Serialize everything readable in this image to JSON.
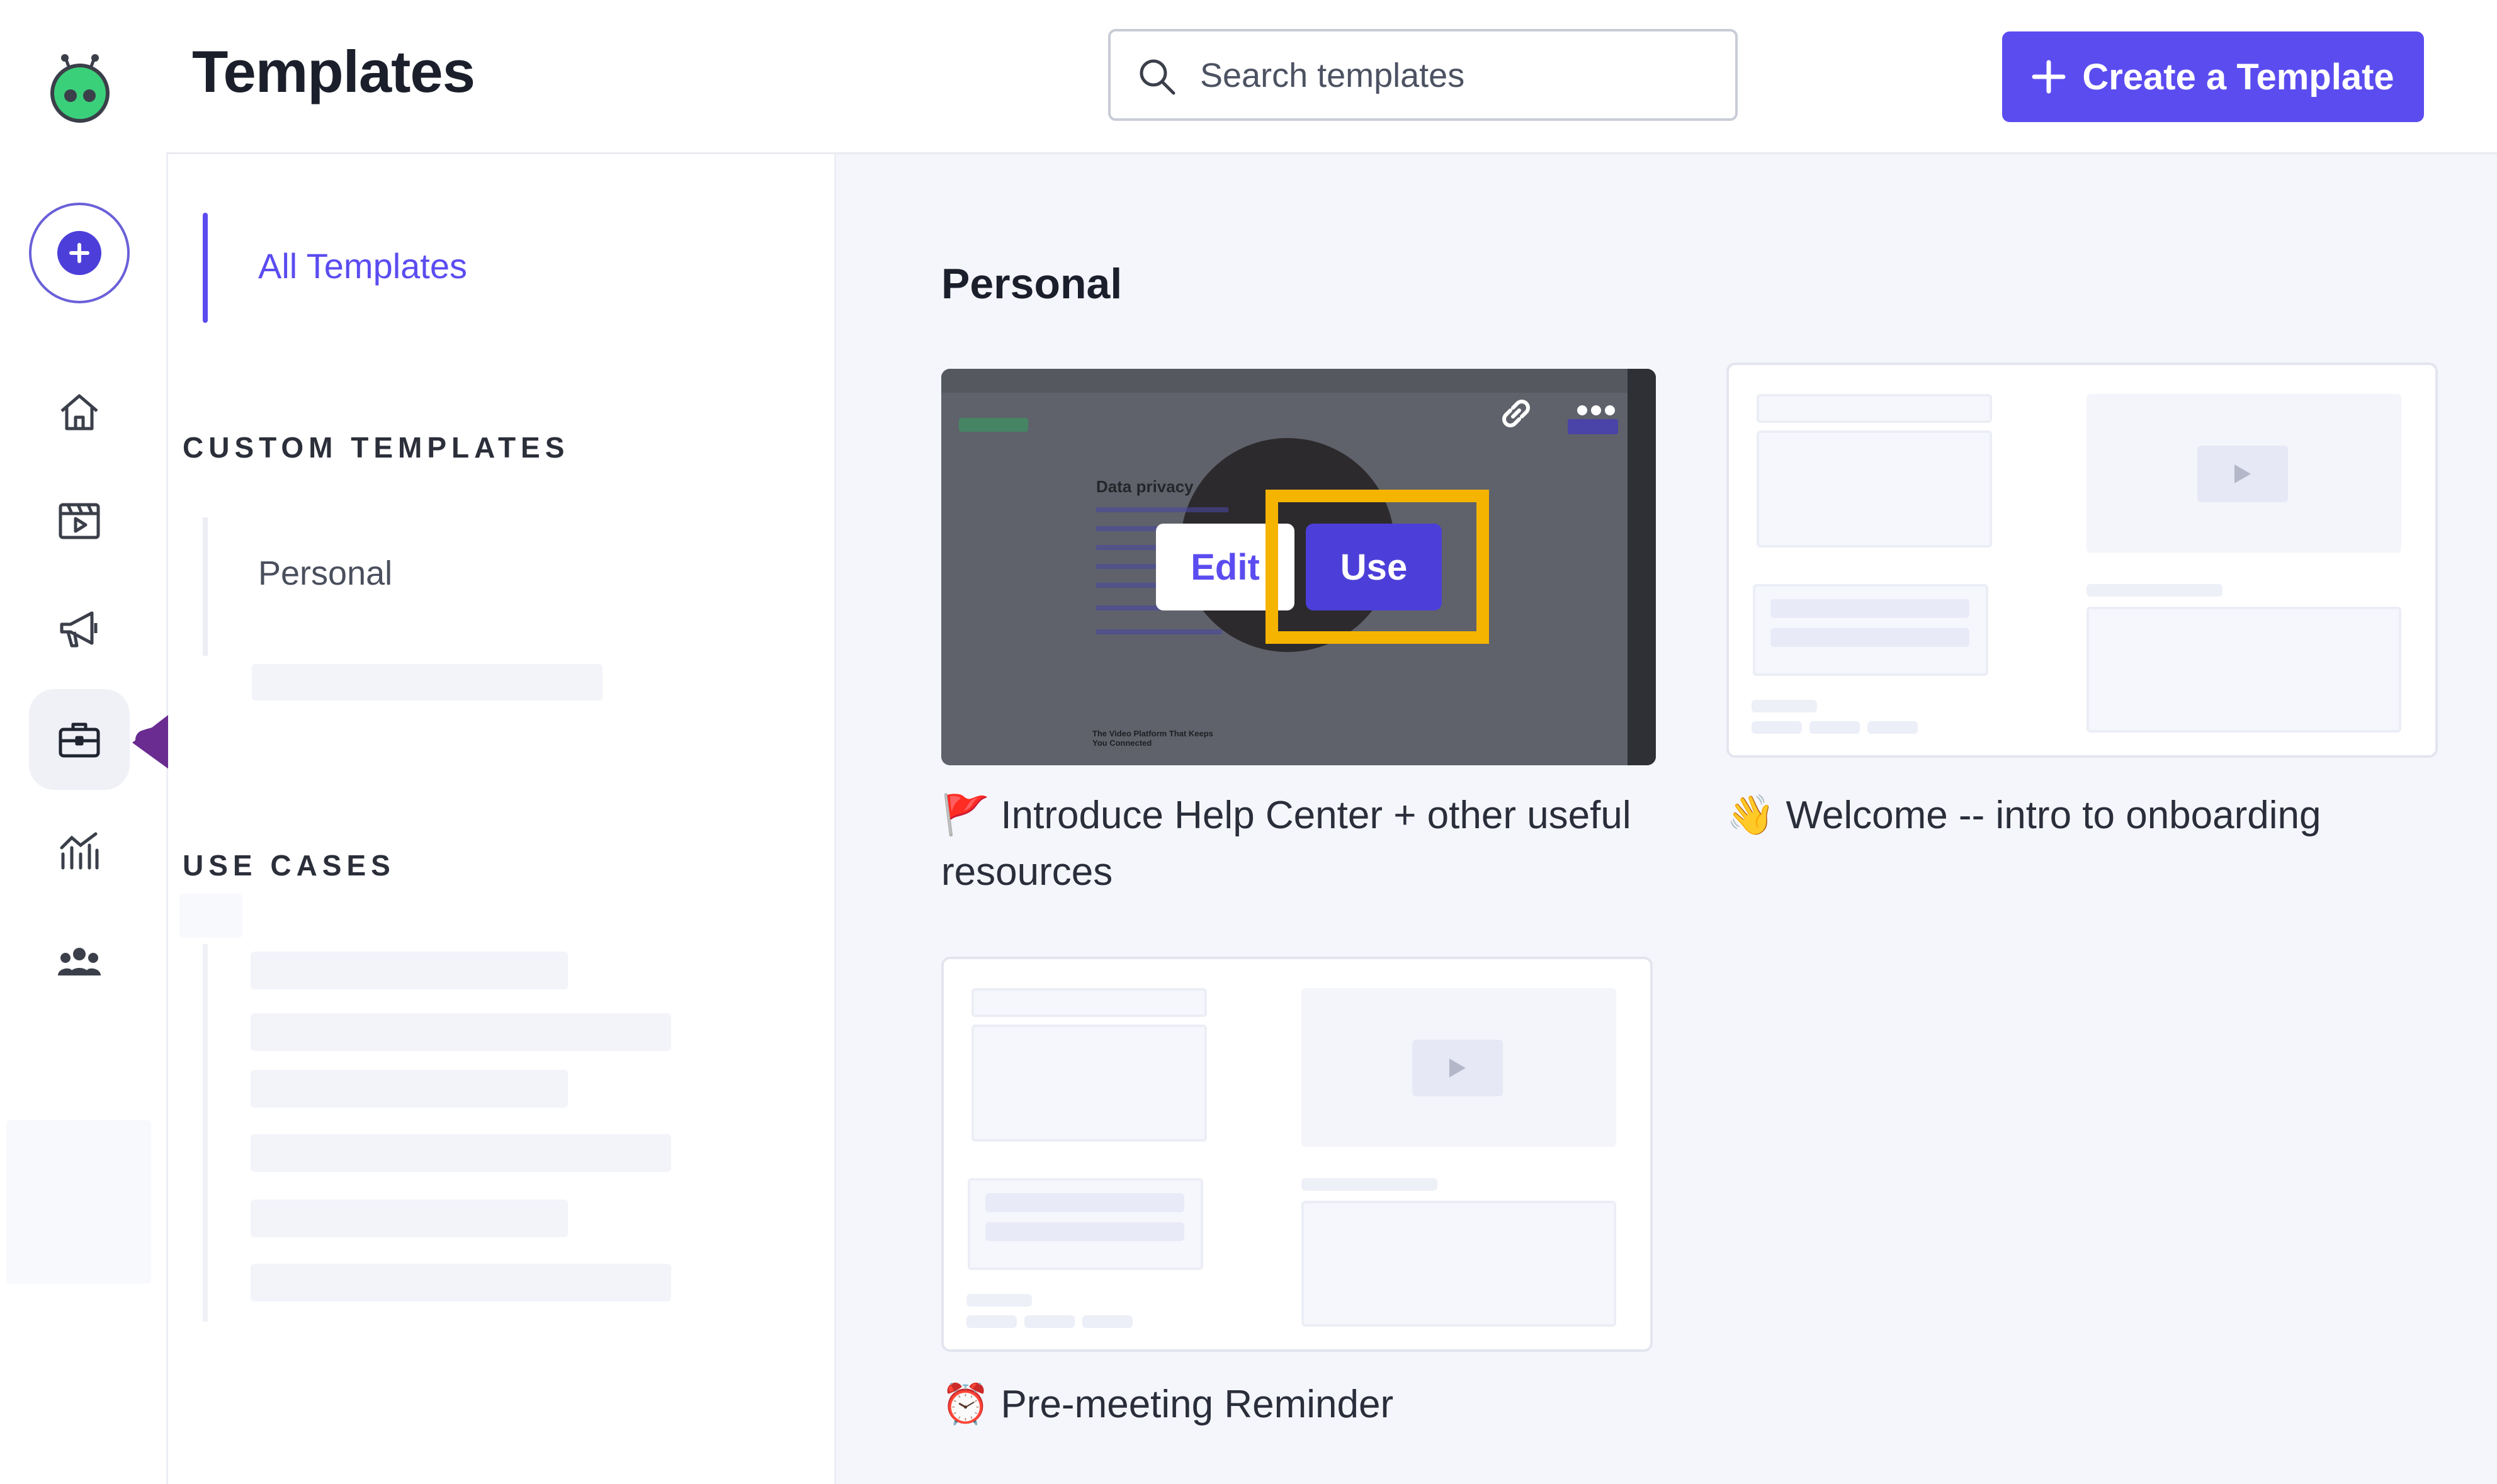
{
  "header": {
    "title": "Templates",
    "search_placeholder": "Search templates",
    "create_label": "Create a Template"
  },
  "sidebar": {
    "all_templates": "All Templates",
    "custom_templates_heading": "CUSTOM TEMPLATES",
    "personal": "Personal",
    "use_cases_heading": "USE CASES"
  },
  "rail": {
    "items": [
      "logo-icon",
      "add-icon",
      "home-icon",
      "video-icon",
      "megaphone-icon",
      "briefcase-icon",
      "analytics-icon",
      "team-icon"
    ],
    "active": "briefcase-icon"
  },
  "main": {
    "section_title": "Personal",
    "cards": [
      {
        "title": "Introduce Help Center + other useful resources",
        "emoji": "🚩"
      },
      {
        "title": "Welcome -- intro to onboarding",
        "emoji": "👋"
      },
      {
        "title": "Pre-meeting Reminder",
        "emoji": "⏰"
      }
    ],
    "hover": {
      "edit_label": "Edit",
      "use_label": "Use"
    },
    "preview": {
      "heading": "Data privacy",
      "footer": "The Video Platform That Keeps You Connected"
    }
  },
  "colors": {
    "accent": "#5b4cf0",
    "highlight": "#f5b400",
    "annotation_arrow": "#6a2c91",
    "background": "#f5f6fc"
  }
}
